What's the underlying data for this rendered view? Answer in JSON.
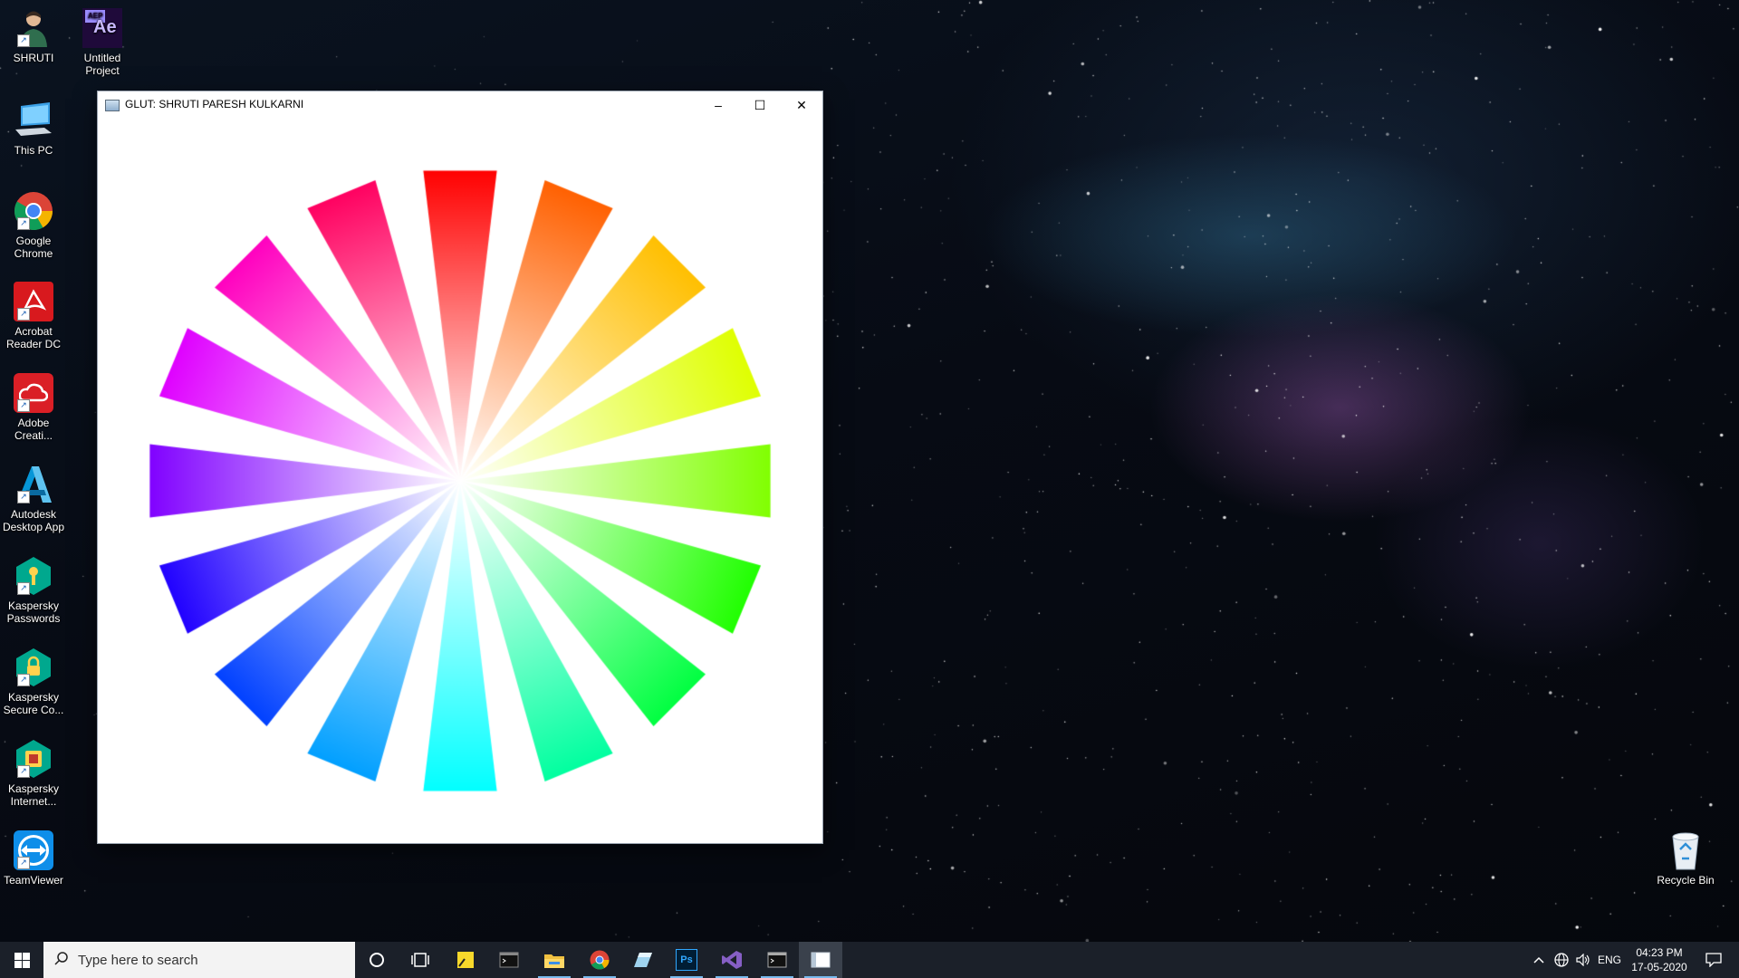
{
  "desktop": {
    "icons": [
      {
        "label": "SHRUTI",
        "icon": "user-icon"
      },
      {
        "label": "Untitled Project",
        "icon": "after-effects-project-icon",
        "badge": "AEP",
        "glyph": "Ae"
      },
      {
        "label": "This PC",
        "icon": "computer-icon"
      },
      {
        "label": "Google Chrome",
        "icon": "chrome-icon"
      },
      {
        "label": "Acrobat Reader DC",
        "icon": "acrobat-icon"
      },
      {
        "label": "Adobe Creati...",
        "icon": "creative-cloud-icon"
      },
      {
        "label": "Autodesk Desktop App",
        "icon": "autodesk-icon"
      },
      {
        "label": "Kaspersky Passwords",
        "icon": "kaspersky-password-icon"
      },
      {
        "label": "Kaspersky Secure Co...",
        "icon": "kaspersky-vpn-icon"
      },
      {
        "label": "Kaspersky Internet...",
        "icon": "kaspersky-internet-icon"
      },
      {
        "label": "TeamViewer",
        "icon": "teamviewer-icon"
      },
      {
        "label": "Recycle Bin",
        "icon": "recycle-bin-icon"
      }
    ]
  },
  "window": {
    "title": "GLUT: SHRUTI PARESH KULKARNI",
    "minimize": "–",
    "maximize": "☐",
    "close": "✕",
    "canvas": {
      "spokes": 16,
      "colors": [
        "#ff0000",
        "#ff8000",
        "#ffff00",
        "#80ff00",
        "#00ff00",
        "#00ff80",
        "#00ffff",
        "#0080ff",
        "#0000ff",
        "#8000ff",
        "#ff00ff",
        "#ff0080"
      ]
    }
  },
  "taskbar": {
    "search_placeholder": "Type here to search",
    "apps": [
      "cortana-icon",
      "task-view-icon",
      "sticky-notes-icon",
      "terminal-icon",
      "file-explorer-icon",
      "chrome-icon",
      "pen-icon",
      "photoshop-icon",
      "visual-studio-icon",
      "command-prompt-icon",
      "glut-app-icon"
    ],
    "ps_glyph": "Ps",
    "tray": {
      "language": "ENG",
      "time": "04:23 PM",
      "date": "17-05-2020"
    }
  }
}
